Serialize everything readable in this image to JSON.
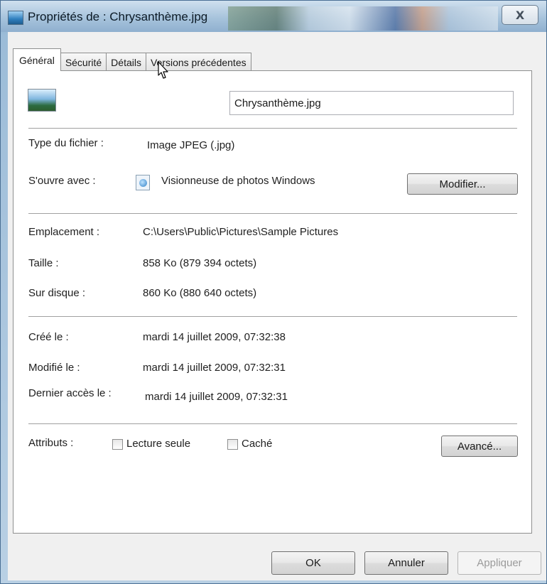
{
  "window": {
    "title": "Propriétés de : Chrysanthème.jpg",
    "close_glyph": "X"
  },
  "tabs": [
    {
      "label": "Général",
      "active": true
    },
    {
      "label": "Sécurité",
      "active": false
    },
    {
      "label": "Détails",
      "active": false
    },
    {
      "label": "Versions précédentes",
      "active": false
    }
  ],
  "general": {
    "file_name": "Chrysanthème.jpg",
    "file_type_label": "Type du fichier :",
    "file_type_value": "Image JPEG (.jpg)",
    "opens_with_label": "S'ouvre avec :",
    "opens_with_value": "Visionneuse de photos Windows",
    "change_button": "Modifier...",
    "location_label": "Emplacement :",
    "location_value": "C:\\Users\\Public\\Pictures\\Sample Pictures",
    "size_label": "Taille :",
    "size_value": "858 Ko (879 394 octets)",
    "size_on_disk_label": "Sur disque :",
    "size_on_disk_value": "860 Ko (880 640 octets)",
    "created_label": "Créé le :",
    "created_value": "mardi 14 juillet 2009, 07:32:38",
    "modified_label": "Modifié le :",
    "modified_value": "mardi 14 juillet 2009, 07:32:31",
    "accessed_label": "Dernier accès le :",
    "accessed_value": "mardi 14 juillet 2009, 07:32:31",
    "attributes_label": "Attributs :",
    "readonly_label": "Lecture seule",
    "hidden_label": "Caché",
    "advanced_button": "Avancé..."
  },
  "footer": {
    "ok_label": "OK",
    "cancel_label": "Annuler",
    "apply_label": "Appliquer"
  },
  "colors": {
    "title_bar": "#a7c3dc",
    "panel_bg": "#ffffff",
    "dialog_bg": "#f0f0f0"
  }
}
